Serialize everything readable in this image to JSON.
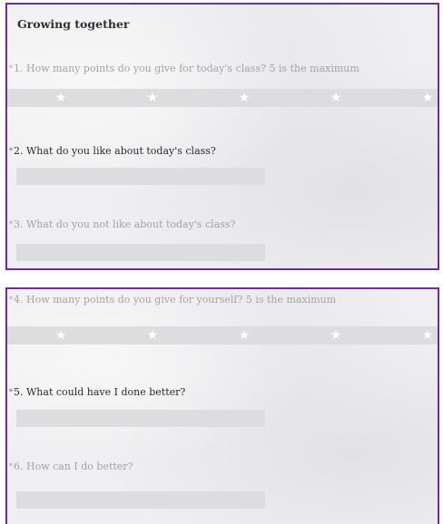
{
  "section1": {
    "title": "Growing together",
    "questions": [
      {
        "required_mark": "*",
        "label": "1. How many points do you give for today's class? 5 is the maximum",
        "type": "rating",
        "max": 5,
        "value": null
      },
      {
        "required_mark": "*",
        "label": "2. What do you like about today's class?",
        "type": "text",
        "value": ""
      },
      {
        "required_mark": "*",
        "label": "3. What do you not like about today's class?",
        "type": "text",
        "value": ""
      }
    ]
  },
  "section2": {
    "questions": [
      {
        "required_mark": "*",
        "label": "4. How many points do you give for yourself? 5 is the maximum",
        "type": "rating",
        "max": 5,
        "value": null
      },
      {
        "required_mark": "*",
        "label": "5. What could have I done better?",
        "type": "text",
        "value": ""
      },
      {
        "required_mark": "*",
        "label": "6. How can I do better?",
        "type": "text",
        "value": ""
      }
    ]
  },
  "icons": {
    "star": "star-icon"
  },
  "colors": {
    "panel_border": "#6a2f99",
    "panel_bg": "#efeef0",
    "field_bg": "#dddcdf"
  }
}
